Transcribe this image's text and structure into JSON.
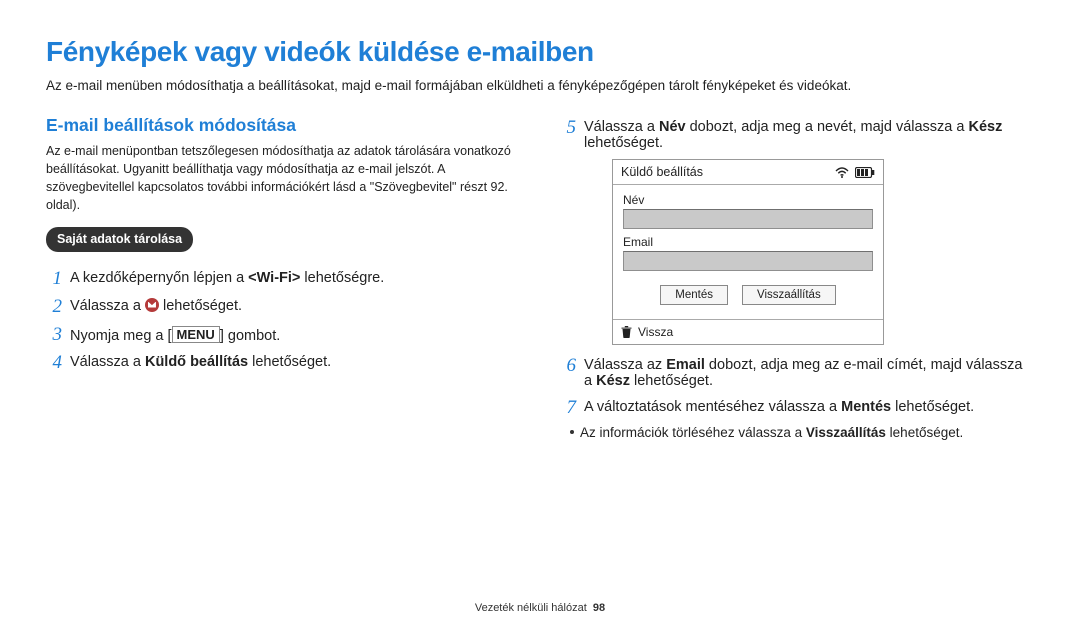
{
  "title": "Fényképek vagy videók küldése e-mailben",
  "lead": "Az e-mail menüben módosíthatja a beállításokat, majd e-mail formájában elküldheti a fényképezőgépen tárolt fényképeket és videókat.",
  "left": {
    "subtitle": "E-mail beállítások módosítása",
    "desc": "Az e-mail menüpontban tetszőlegesen módosíthatja az adatok tárolására vonatkozó beállításokat. Ugyanitt beállíthatja vagy módosíthatja az e-mail jelszót. A szövegbevitellel kapcsolatos további információkért lásd a \"Szövegbevitel\" részt 92. oldal).",
    "pill": "Saját adatok tárolása",
    "steps": [
      {
        "n": "1",
        "pre": "A kezdőképernyőn lépjen a ",
        "bold": "<Wi-Fi>",
        "post": " lehetőségre."
      },
      {
        "n": "2",
        "type": "icon",
        "pre": "Válassza a ",
        "post": " lehetőséget."
      },
      {
        "n": "3",
        "type": "menu",
        "pre": "Nyomja meg a [",
        "menu": "MENU",
        "post": "] gombot."
      },
      {
        "n": "4",
        "pre": "Válassza a ",
        "bold": "Küldő beállítás",
        "post": " lehetőséget."
      }
    ]
  },
  "right": {
    "steps5": {
      "n": "5",
      "pre": "Válassza a ",
      "bold1": "Név",
      "mid": " dobozt, adja meg a nevét, majd válassza a ",
      "bold2": "Kész",
      "post": " lehetőséget."
    },
    "device": {
      "hdr": "Küldő beállítás",
      "name_lbl": "Név",
      "email_lbl": "Email",
      "save": "Mentés",
      "reset": "Visszaállítás",
      "back": "Vissza"
    },
    "steps67": [
      {
        "n": "6",
        "pre": "Válassza az ",
        "bold1": "Email",
        "mid": " dobozt, adja meg az e-mail címét, majd válassza a ",
        "bold2": "Kész",
        "post": " lehetőséget."
      },
      {
        "n": "7",
        "pre": "A változtatások mentéséhez válassza a ",
        "bold1": "Mentés",
        "post": " lehetőséget."
      }
    ],
    "bullet": {
      "pre": "Az információk törléséhez válassza a ",
      "bold": "Visszaállítás",
      "post": " lehetőséget."
    }
  },
  "footer": {
    "section": "Vezeték nélküli hálózat",
    "page": "98"
  }
}
